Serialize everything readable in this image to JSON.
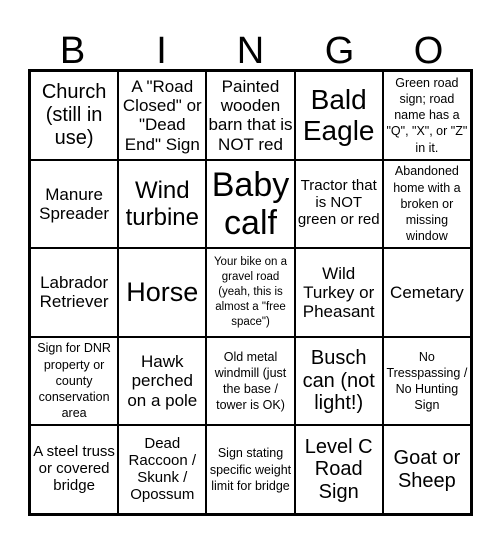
{
  "header": {
    "letters": [
      "B",
      "I",
      "N",
      "G",
      "O"
    ]
  },
  "board": {
    "cells": [
      [
        "Church (still in use)",
        "A \"Road Closed\" or \"Dead End\" Sign",
        "Painted wooden barn that is NOT red",
        "Bald Eagle",
        "Green road sign; road name has a \"Q\", \"X\", or \"Z\" in it."
      ],
      [
        "Manure Spreader",
        "Wind turbine",
        "Baby calf",
        "Tractor that is NOT green or red",
        "Abandoned home with a broken or missing window"
      ],
      [
        "Labrador Retriever",
        "Horse",
        "Your bike on a gravel road (yeah, this is almost a \"free space\")",
        "Wild Turkey or Pheasant",
        "Cemetary"
      ],
      [
        "Sign for DNR property or county conservation area",
        "Hawk perched on a pole",
        "Old metal windmill (just the base / tower is OK)",
        "Busch can (not light!)",
        "No Tresspassing / No Hunting Sign"
      ],
      [
        "A steel truss or covered bridge",
        "Dead Raccoon / Skunk / Opossum",
        "Sign stating specific weight limit for bridge",
        "Level C Road Sign",
        "Goat or Sheep"
      ]
    ]
  }
}
